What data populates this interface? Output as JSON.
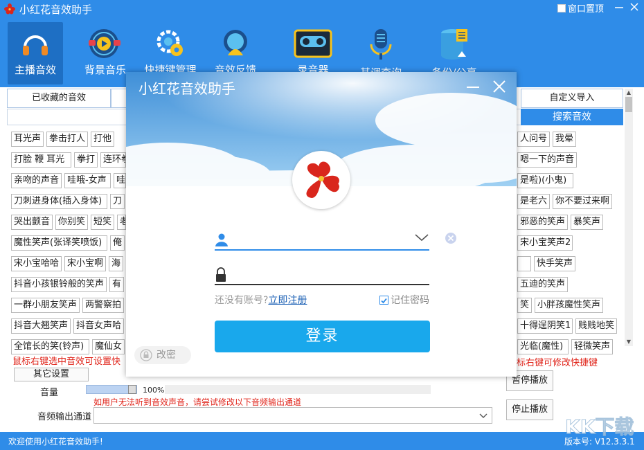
{
  "app": {
    "title": "小红花音效助手",
    "pin_label": "窗口置顶"
  },
  "toolbar": [
    {
      "label": "主播音效",
      "icon": "headphones-icon",
      "active": true
    },
    {
      "label": "背景音乐",
      "icon": "music-player-icon",
      "active": false
    },
    {
      "label": "快捷键管理",
      "icon": "gear-icon",
      "active": false
    },
    {
      "label": "音效反馈",
      "icon": "webcam-icon",
      "active": false
    },
    {
      "label": "录音器",
      "icon": "cassette-icon",
      "active": false
    },
    {
      "label": "其调查询",
      "icon": "microphone-icon",
      "active": false
    },
    {
      "label": "备份/公享",
      "icon": "database-upload-icon",
      "active": false
    }
  ],
  "tabs": {
    "favorites": "已收藏的音效",
    "custom_import": "自定义导入",
    "search_button": "搜索音效"
  },
  "chips_left": [
    [
      "耳光声",
      "拳击打人",
      "打他"
    ],
    [
      "打脸 鞭 耳光",
      "拳打",
      "连环拳"
    ],
    [
      "亲吻的声音",
      "哇哦-女声",
      "哇"
    ],
    [
      "刀刺进身体(插入身体)",
      "刀"
    ],
    [
      "哭出颤音",
      "你别笑",
      "短笑",
      "老"
    ],
    [
      "魔性笑声(张译笑喷饭)",
      "俺"
    ],
    [
      "宋小宝哈哈",
      "宋小宝啊",
      "海"
    ],
    [
      "抖音小孩银铃般的笑声",
      "有"
    ],
    [
      "一群小朋友笑声",
      "两警察拍"
    ],
    [
      "抖音大翘笑声",
      "抖音女声哈"
    ],
    [
      "全馆长的笑(铃声)",
      "魔仙女"
    ]
  ],
  "chips_right": [
    [
      "人问号",
      "我晕"
    ],
    [
      "嗯一下的声音"
    ],
    [
      "是啦)(小鬼)"
    ],
    [
      "是老六",
      "你不要过来啊"
    ],
    [
      "邪恶的笑声",
      "暴笑声"
    ],
    [
      "宋小宝笑声2"
    ],
    [
      "",
      "快手笑声"
    ],
    [
      "五迪的笑声"
    ],
    [
      "笑",
      "小胖孩魔性笑声"
    ],
    [
      "十得逞阴笑1",
      "贱贱地笑"
    ],
    [
      "光临(魔性)",
      "轻微笑声"
    ]
  ],
  "tips": {
    "left": "鼠标右键选中音效可设置快",
    "right": "标右键可修改快捷键",
    "audio_hint": "如用户无法听到音效声音，请尝试修改以下音频输出通道"
  },
  "controls": {
    "other_settings": "其它设置",
    "volume_label": "音量",
    "volume_value": 100,
    "volume_text": "100%",
    "output_label": "音频输出通道",
    "output_value": "",
    "pause_button": "暂停播放",
    "stop_button": "停止播放"
  },
  "status": {
    "welcome": "欢迎使用小红花音效助手!",
    "version": "版本号: V12.3.3.1"
  },
  "watermark": "KK下载",
  "login": {
    "title": "小红花音效助手",
    "username_value": "",
    "password_value": "",
    "no_account": "还没有账号?",
    "register": "立即注册",
    "remember": "记住密码",
    "remember_checked": true,
    "submit": "登录",
    "change_password": "改密"
  },
  "colors": {
    "brand_blue": "#2f8ce8",
    "active_tab": "#1e6fc4",
    "login_button": "#19a8ec",
    "tip_red": "#e0241a"
  }
}
